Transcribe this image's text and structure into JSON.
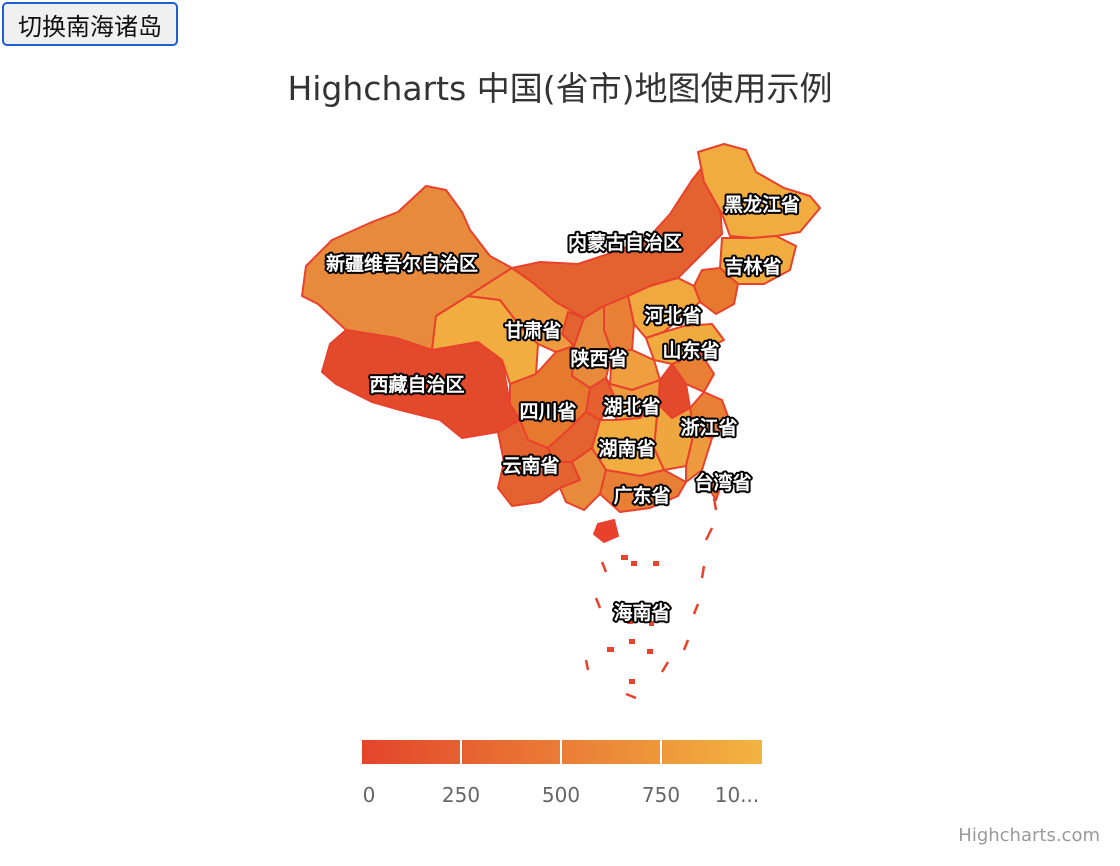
{
  "button": {
    "label": "切换南海诸岛"
  },
  "title": "Highcharts 中国(省市)地图使用示例",
  "credits": "Highcharts.com",
  "colors": {
    "min": "#e3452b",
    "max": "#f2b440",
    "border": "#e8412c"
  },
  "colorAxis": {
    "ticks": [
      "0",
      "250",
      "500",
      "750",
      "10..."
    ]
  },
  "provinces": [
    {
      "id": "xinjiang",
      "name": "新疆维吾尔自治区"
    },
    {
      "id": "xizang",
      "name": "西藏自治区"
    },
    {
      "id": "neimenggu",
      "name": "内蒙古自治区"
    },
    {
      "id": "heilongjiang",
      "name": "黑龙江省"
    },
    {
      "id": "jilin",
      "name": "吉林省"
    },
    {
      "id": "gansu",
      "name": "甘肃省"
    },
    {
      "id": "hebei",
      "name": "河北省"
    },
    {
      "id": "shandong",
      "name": "山东省"
    },
    {
      "id": "shaanxi",
      "name": "陕西省"
    },
    {
      "id": "sichuan",
      "name": "四川省"
    },
    {
      "id": "hubei",
      "name": "湖北省"
    },
    {
      "id": "zhejiang",
      "name": "浙江省"
    },
    {
      "id": "hunan",
      "name": "湖南省"
    },
    {
      "id": "yunnan",
      "name": "云南省"
    },
    {
      "id": "taiwan",
      "name": "台湾省"
    },
    {
      "id": "guangdong",
      "name": "广东省"
    },
    {
      "id": "hainan",
      "name": "海南省"
    }
  ]
}
